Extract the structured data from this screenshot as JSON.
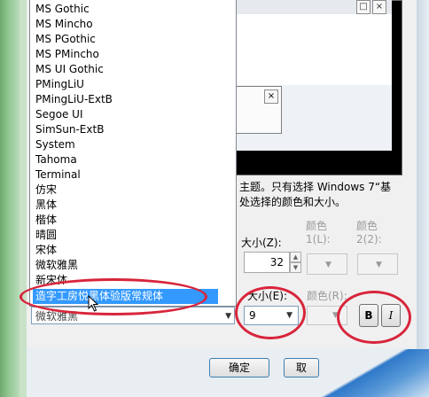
{
  "font_list": {
    "items": [
      "MS Gothic",
      "MS Mincho",
      "MS PGothic",
      "MS PMincho",
      "MS UI Gothic",
      "PMingLiU",
      "PMingLiU-ExtB",
      "Segoe UI",
      "SimSun-ExtB",
      "System",
      "Tahoma",
      "Terminal",
      "仿宋",
      "黑体",
      "楷体",
      "晴圆",
      "宋体",
      "微软雅黑",
      "新宋体"
    ],
    "selected": "造字工房悦黑体验版常规体",
    "current_value": "微软雅黑"
  },
  "description": {
    "line1": "主题。只有选择 Windows 7“基",
    "line2": "处选择的颜色和大小。"
  },
  "labels": {
    "size_top": "大小(Z):",
    "color1": "颜色",
    "color1_sub": "1(L):",
    "color2": "颜色",
    "color2_sub": "2(2):",
    "size_font": "大小(E):",
    "color_font": "颜色(R):"
  },
  "values": {
    "item_size": "32",
    "font_size": "9"
  },
  "format": {
    "bold": "B",
    "italic": "I"
  },
  "buttons": {
    "ok": "确定",
    "cancel": "取"
  },
  "preview": {
    "close_glyph": "×"
  },
  "colors": {
    "annotation_red": "#d8253b",
    "selection_blue": "#3399ff"
  }
}
